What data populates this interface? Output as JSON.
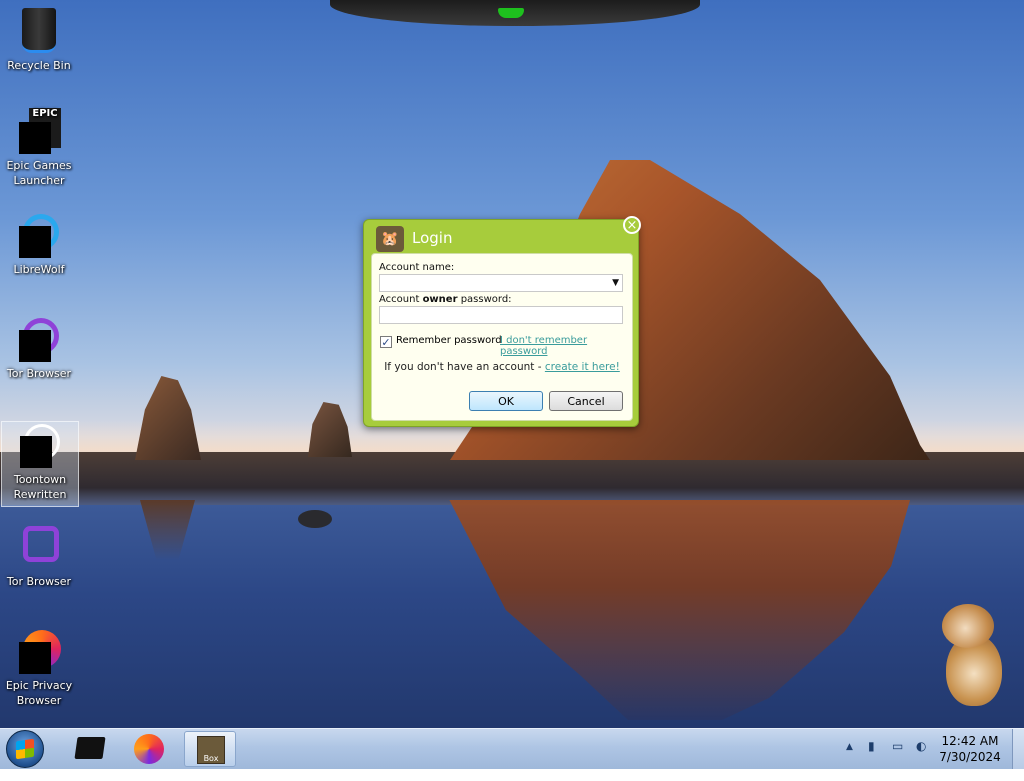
{
  "desktop": {
    "icons": [
      {
        "label": "Recycle Bin",
        "icon": "recycle-bin-icon"
      },
      {
        "label": "Epic Games Launcher",
        "icon": "epic-games-icon",
        "tile_text": "EPIC"
      },
      {
        "label": "LibreWolf",
        "icon": "librewolf-icon"
      },
      {
        "label": "Tor Browser",
        "icon": "tor-browser-icon"
      },
      {
        "label": "Toontown Rewritten",
        "icon": "toontown-icon"
      },
      {
        "label": "Tor Browser",
        "icon": "tor-browser-icon"
      },
      {
        "label": "Epic Privacy Browser",
        "icon": "epic-privacy-browser-icon"
      }
    ]
  },
  "dialog": {
    "title": "Login",
    "close_symbol": "×",
    "account_name_label": "Account name:",
    "account_name_value": "",
    "password_label_prefix": "Account ",
    "password_label_bold": "owner",
    "password_label_suffix": " password:",
    "password_value": "",
    "remember_label": "Remember password",
    "remember_checked": true,
    "forgot_link": "I don't remember password",
    "no_account_text": "If you don't have an account - ",
    "create_link": "create it here!",
    "ok_label": "OK",
    "cancel_label": "Cancel"
  },
  "taskbar": {
    "pinned": [
      "start-button",
      "epic-games-launcher",
      "epic-privacy-browser",
      "box-app"
    ],
    "active_app": "box-app",
    "box_label": "Box",
    "tray": {
      "show_hidden": "▲"
    },
    "clock": {
      "time": "12:42 AM",
      "date": "7/30/2024"
    }
  },
  "colors": {
    "dialog_green": "#a7cc3c",
    "dialog_body": "#fffff0",
    "link": "#3a9c9c",
    "taskbar": "#aec5e4"
  }
}
